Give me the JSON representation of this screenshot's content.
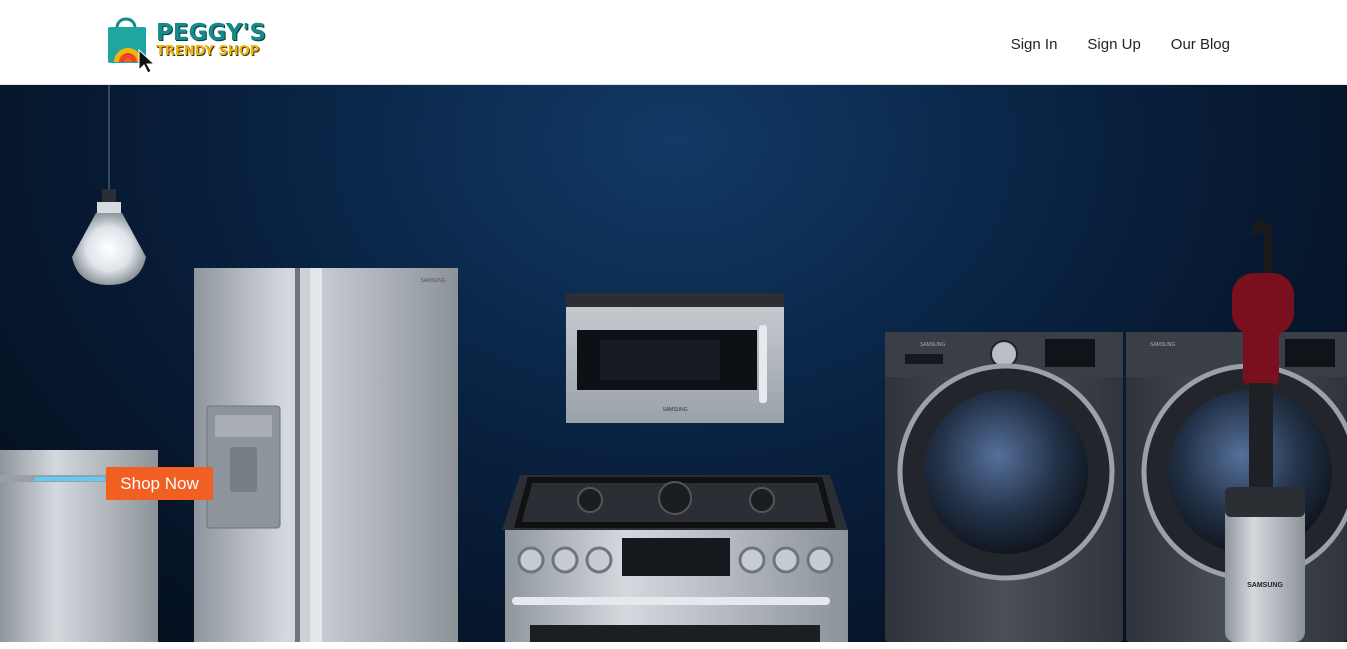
{
  "brand": {
    "line1": "PEGGY'S",
    "line2": "TRENDY SHOP",
    "colors": {
      "teal": "#148a8a",
      "yellow": "#f2b705",
      "orange": "#f25f22"
    },
    "icon": "shopping-bag-cursor-icon"
  },
  "nav": {
    "items": [
      {
        "label": "Sign In"
      },
      {
        "label": "Sign Up"
      },
      {
        "label": "Our Blog"
      }
    ]
  },
  "hero": {
    "cta_label": "Shop Now",
    "cta_color": "#f25f22",
    "background_color": "#0a2648",
    "brand_marks": {
      "fridge": "SAMSUNG",
      "washer": "SAMSUNG",
      "dryer": "SAMSUNG",
      "vacuum": "SAMSUNG",
      "microwave": "SAMSUNG"
    }
  }
}
